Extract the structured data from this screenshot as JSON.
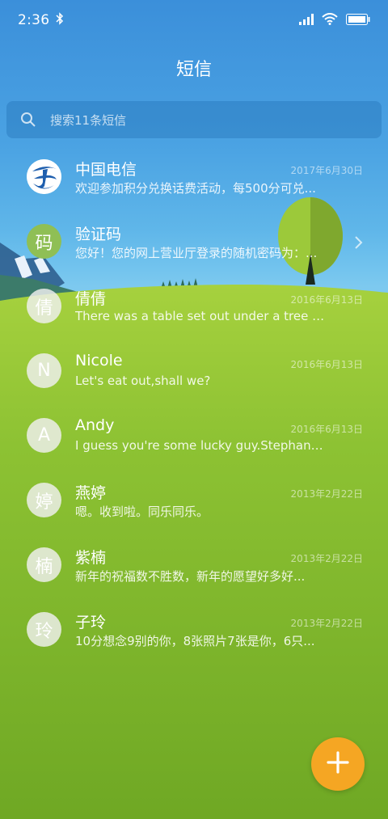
{
  "status_bar": {
    "time": "2:36",
    "icons": [
      "bluetooth-icon",
      "signal-icon",
      "wifi-icon",
      "battery-icon"
    ]
  },
  "header": {
    "title": "短信"
  },
  "search": {
    "placeholder": "搜索11条短信"
  },
  "conversations": [
    {
      "name": "中国电信",
      "date": "2017年6月30日",
      "snippet": "欢迎参加积分兑换话费活动，每500分可兑...",
      "avatar_type": "logo",
      "avatar_text": ""
    },
    {
      "name": "验证码",
      "date": "",
      "snippet": "您好！您的网上营业厅登录的随机密码为：...",
      "avatar_type": "green",
      "avatar_text": "码"
    },
    {
      "name": "倩倩",
      "date": "2016年6月13日",
      "snippet": "There was a table set out under a tree in...",
      "avatar_type": "plain",
      "avatar_text": "倩"
    },
    {
      "name": "Nicole",
      "date": "2016年6月13日",
      "snippet": "Let's eat out,shall we?",
      "avatar_type": "plain",
      "avatar_text": "N"
    },
    {
      "name": "Andy",
      "date": "2016年6月13日",
      "snippet": "I guess you're some lucky guy.Stephani...",
      "avatar_type": "plain",
      "avatar_text": "A"
    },
    {
      "name": "燕婷",
      "date": "2013年2月22日",
      "snippet": "嗯。收到啦。同乐同乐。",
      "avatar_type": "plain",
      "avatar_text": "婷"
    },
    {
      "name": "紫楠",
      "date": "2013年2月22日",
      "snippet": "新年的祝福数不胜数，新年的愿望好多好...",
      "avatar_type": "plain",
      "avatar_text": "楠"
    },
    {
      "name": "子玲",
      "date": "2013年2月22日",
      "snippet": "10分想念9别的你，8张照片7张是你，6只...",
      "avatar_type": "plain",
      "avatar_text": "玲"
    }
  ],
  "fab": {
    "icon": "plus-icon",
    "color": "#f5a623"
  },
  "colors": {
    "sky_top": "#3b8fda",
    "grass": "#7eb02a",
    "fab": "#f5a623"
  }
}
